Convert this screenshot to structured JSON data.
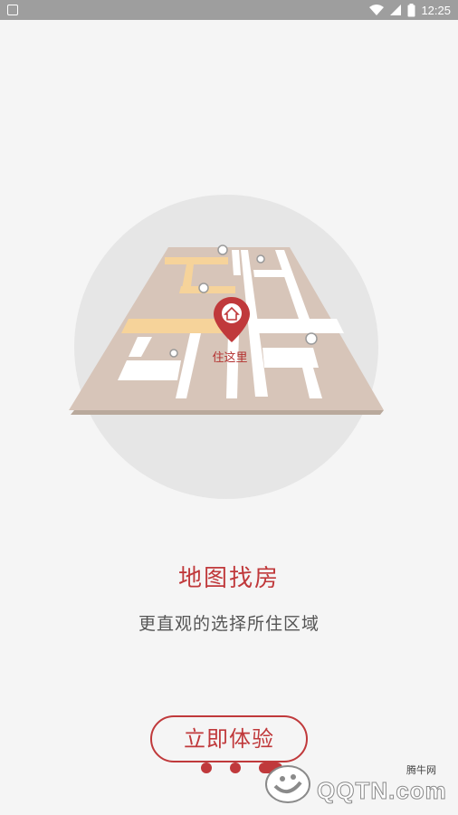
{
  "status_bar": {
    "time": "12:25",
    "icons": [
      "notification-icon",
      "wifi-icon",
      "signal-icon",
      "battery-icon"
    ]
  },
  "illustration": {
    "pin_label": "住这里",
    "pin_icon": "home-icon"
  },
  "headline": "地图找房",
  "subheadline": "更直观的选择所住区域",
  "cta_label": "立即体验",
  "pager": {
    "count": 3,
    "active_index": 2
  },
  "watermark": {
    "small_text": "腾牛网",
    "brand_text": "QQTN.com"
  },
  "colors": {
    "accent": "#c0393b",
    "background": "#f5f5f5",
    "status_bar": "#9e9e9e"
  }
}
